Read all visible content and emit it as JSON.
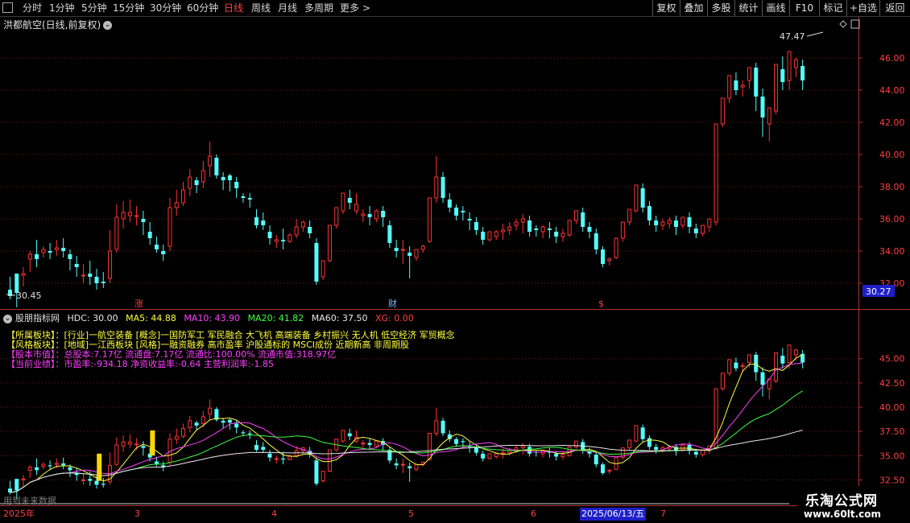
{
  "toolbar": {
    "periods": [
      "分时",
      "1分钟",
      "5分钟",
      "15分钟",
      "30分钟",
      "60分钟",
      "日线",
      "周线",
      "月线",
      "多周期",
      "更多 >"
    ],
    "active_period": "日线",
    "buttons": [
      "复权",
      "叠加",
      "多股",
      "统计",
      "画线",
      "F10",
      "标记",
      "+自选",
      "返回"
    ]
  },
  "stock": {
    "title": "洪都航空(日线,前复权)"
  },
  "main_chart": {
    "y_ticks": [
      "46.00",
      "44.00",
      "42.00",
      "40.00",
      "38.00",
      "36.00",
      "34.00",
      "32.00"
    ],
    "high_label": "47.47",
    "low_label": "30.45",
    "price_tag": "30.27",
    "events": [
      "涨",
      "财",
      "$"
    ]
  },
  "indicator": {
    "name": "股朋指标网",
    "values": [
      {
        "label": "HDC: 30.00",
        "color": "#e8e8e8"
      },
      {
        "label": "MA5: 44.88",
        "color": "#ffff40"
      },
      {
        "label": "MA10: 43.90",
        "color": "#ff40ff"
      },
      {
        "label": "MA20: 41.82",
        "color": "#40ff40"
      },
      {
        "label": "MA60: 37.50",
        "color": "#e8e8e8"
      },
      {
        "label": "XG: 0.00",
        "color": "#ff4040"
      }
    ],
    "y_ticks": [
      "45.00",
      "42.50",
      "40.00",
      "37.50",
      "35.00",
      "32.50"
    ]
  },
  "info_lines": [
    {
      "label": "【所属板块】：",
      "text": "[行业]一航空装备 [概念]一国防军工 军民融合 大飞机 高端装备 乡村振兴 无人机 低空经济 军贸概念",
      "color": "#ffff40"
    },
    {
      "label": "【风格板块】：",
      "text": "[地域]一江西板块 [风格]一融资融券 高市盈率 沪股通标的 MSCI成份 近期新高 非周期股",
      "color": "#ffff40"
    },
    {
      "label": "【股本市值】：",
      "text": "总股本:7.17亿 流通盘:7.17亿 流通比:100.00% 流通市值:318.97亿",
      "color": "#ff40ff"
    },
    {
      "label": "【当前业绩】：",
      "text": "市盈率:-934.18 净资收益率:-0.64 主营利润率:-1.85",
      "color": "#ff40ff"
    }
  ],
  "no_future": "用到未来数据",
  "dates": {
    "year": "2025年",
    "months": [
      "3",
      "4",
      "5",
      "6",
      "7"
    ],
    "cursor_date": "2025/06/13/五"
  },
  "watermark": {
    "name": "乐淘公式网",
    "url": "www.60lt.com"
  },
  "chart_data": {
    "type": "candlestick",
    "up_color": "#ff3232",
    "down_color": "#54fcfc",
    "main_ylim": [
      31,
      47.8
    ],
    "candles": [
      [
        31.6,
        32.4,
        31.2,
        31.0
      ],
      [
        32.6,
        32.0,
        31.4,
        30.5
      ],
      [
        32.5,
        33.0,
        32.6,
        31.8
      ],
      [
        33.5,
        34.0,
        33.8,
        32.7
      ],
      [
        33.8,
        34.7,
        33.5,
        33.0
      ],
      [
        33.9,
        34.3,
        34.1,
        33.6
      ],
      [
        34.0,
        34.5,
        33.9,
        33.5
      ],
      [
        34.1,
        34.7,
        34.2,
        33.7
      ],
      [
        34.2,
        34.8,
        34.0,
        33.6
      ],
      [
        33.8,
        34.1,
        33.5,
        32.8
      ],
      [
        33.2,
        33.7,
        33.0,
        32.4
      ],
      [
        32.5,
        33.2,
        32.5,
        32.0
      ],
      [
        32.6,
        33.4,
        32.4,
        31.9
      ],
      [
        32.4,
        32.9,
        32.0,
        31.6
      ],
      [
        32.1,
        32.7,
        32.0,
        31.7
      ],
      [
        32.3,
        35.3,
        34.0,
        32.0
      ],
      [
        34.1,
        36.9,
        36.1,
        33.9
      ],
      [
        36.0,
        37.1,
        36.4,
        35.4
      ],
      [
        36.2,
        37.2,
        36.4,
        35.8
      ],
      [
        36.2,
        36.8,
        36.2,
        35.6
      ],
      [
        36.0,
        36.5,
        35.8,
        35.0
      ],
      [
        35.2,
        35.8,
        34.8,
        34.4
      ],
      [
        34.4,
        34.9,
        34.1,
        33.9
      ],
      [
        34.0,
        34.4,
        33.8,
        33.4
      ],
      [
        34.3,
        37.3,
        36.7,
        34.0
      ],
      [
        36.7,
        37.8,
        37.0,
        36.2
      ],
      [
        37.0,
        38.3,
        37.8,
        36.8
      ],
      [
        37.9,
        39.1,
        38.6,
        37.4
      ],
      [
        38.4,
        38.6,
        38.1,
        37.6
      ],
      [
        38.3,
        39.6,
        39.0,
        37.9
      ],
      [
        39.3,
        40.8,
        39.9,
        38.6
      ],
      [
        39.8,
        40.0,
        38.7,
        38.5
      ],
      [
        38.6,
        38.9,
        38.4,
        37.8
      ],
      [
        38.7,
        38.8,
        38.4,
        37.7
      ],
      [
        38.3,
        38.6,
        37.9,
        37.3
      ],
      [
        37.4,
        37.6,
        37.3,
        37.0
      ],
      [
        37.3,
        37.6,
        37.2,
        36.7
      ],
      [
        36.1,
        36.6,
        35.6,
        35.4
      ],
      [
        35.9,
        36.4,
        35.6,
        35.3
      ],
      [
        35.2,
        35.6,
        34.8,
        34.4
      ],
      [
        34.6,
        35.0,
        34.7,
        34.2
      ],
      [
        34.7,
        35.4,
        34.6,
        34.1
      ],
      [
        34.6,
        35.1,
        35.0,
        34.5
      ],
      [
        35.0,
        36.0,
        35.5,
        34.8
      ],
      [
        35.5,
        35.9,
        35.8,
        35.2
      ],
      [
        35.5,
        35.9,
        35.1,
        34.8
      ],
      [
        34.5,
        34.8,
        32.1,
        31.9
      ],
      [
        32.4,
        32.6,
        33.4,
        32.2
      ],
      [
        33.4,
        34.1,
        35.6,
        33.3
      ],
      [
        35.6,
        36.0,
        36.7,
        35.4
      ],
      [
        36.5,
        36.9,
        37.6,
        36.3
      ],
      [
        37.3,
        37.8,
        37.0,
        36.6
      ],
      [
        36.5,
        37.6,
        36.9,
        36.3
      ],
      [
        36.2,
        36.6,
        36.3,
        35.8
      ],
      [
        36.3,
        36.8,
        36.1,
        35.6
      ],
      [
        36.0,
        36.6,
        36.5,
        35.8
      ],
      [
        36.5,
        36.8,
        36.1,
        35.5
      ],
      [
        35.6,
        35.9,
        34.5,
        34.2
      ],
      [
        34.2,
        34.7,
        34.0,
        33.6
      ],
      [
        34.1,
        34.7,
        34.1,
        33.2
      ],
      [
        33.9,
        34.3,
        33.7,
        32.3
      ],
      [
        33.6,
        33.9,
        34.1,
        33.4
      ],
      [
        34.1,
        34.4,
        34.3,
        33.9
      ],
      [
        34.6,
        36.5,
        37.3,
        34.5
      ],
      [
        37.3,
        39.9,
        38.6,
        37.0
      ],
      [
        38.6,
        38.9,
        37.3,
        37.0
      ],
      [
        37.2,
        37.6,
        36.7,
        36.4
      ],
      [
        36.7,
        36.9,
        36.2,
        35.9
      ],
      [
        36.5,
        36.8,
        36.4,
        35.9
      ],
      [
        36.0,
        36.4,
        35.9,
        35.3
      ],
      [
        35.8,
        36.1,
        35.3,
        35.0
      ],
      [
        35.2,
        35.5,
        34.7,
        34.4
      ],
      [
        34.7,
        35.2,
        35.2,
        34.6
      ],
      [
        34.9,
        35.3,
        35.2,
        34.7
      ],
      [
        35.2,
        35.7,
        35.3,
        34.7
      ],
      [
        35.3,
        35.8,
        35.5,
        35.0
      ],
      [
        35.6,
        36.0,
        35.8,
        35.3
      ],
      [
        35.8,
        36.3,
        36.0,
        35.1
      ],
      [
        35.9,
        36.2,
        35.2,
        34.9
      ],
      [
        35.4,
        35.6,
        35.3,
        34.9
      ],
      [
        35.2,
        35.6,
        35.5,
        34.8
      ],
      [
        35.4,
        35.8,
        35.3,
        34.8
      ],
      [
        35.2,
        35.5,
        34.9,
        34.5
      ],
      [
        34.9,
        35.4,
        35.1,
        34.6
      ],
      [
        35.0,
        35.6,
        35.9,
        34.9
      ],
      [
        35.9,
        36.3,
        36.5,
        35.7
      ],
      [
        36.4,
        36.7,
        35.5,
        35.2
      ],
      [
        35.5,
        35.8,
        35.2,
        34.8
      ],
      [
        35.1,
        35.4,
        34.1,
        33.8
      ],
      [
        34.1,
        34.3,
        33.2,
        33.0
      ],
      [
        33.4,
        33.6,
        33.5,
        33.1
      ],
      [
        33.6,
        34.0,
        34.8,
        33.5
      ],
      [
        34.8,
        35.2,
        35.8,
        34.6
      ],
      [
        35.8,
        36.2,
        36.6,
        35.6
      ],
      [
        36.5,
        37.4,
        38.1,
        36.4
      ],
      [
        37.9,
        38.2,
        36.7,
        36.4
      ],
      [
        36.8,
        37.1,
        35.9,
        35.6
      ],
      [
        35.9,
        36.2,
        35.6,
        35.2
      ],
      [
        35.6,
        36.0,
        35.8,
        35.3
      ],
      [
        35.7,
        36.1,
        35.9,
        35.4
      ],
      [
        35.9,
        36.2,
        35.5,
        35.0
      ],
      [
        35.6,
        35.9,
        36.1,
        35.4
      ],
      [
        36.1,
        36.4,
        35.5,
        35.1
      ],
      [
        35.4,
        35.7,
        35.1,
        34.8
      ],
      [
        35.1,
        35.5,
        35.6,
        34.9
      ],
      [
        35.5,
        35.9,
        36.0,
        35.2
      ],
      [
        35.8,
        36.4,
        41.9,
        35.6
      ],
      [
        41.9,
        42.4,
        43.5,
        41.7
      ],
      [
        43.5,
        44.6,
        44.9,
        43.2
      ],
      [
        44.6,
        45.1,
        44.0,
        43.7
      ],
      [
        44.2,
        44.6,
        44.3,
        43.6
      ],
      [
        44.6,
        44.9,
        45.4,
        44.1
      ],
      [
        45.4,
        45.7,
        43.6,
        42.7
      ],
      [
        43.6,
        44.1,
        42.3,
        41.1
      ],
      [
        41.9,
        42.4,
        42.9,
        40.8
      ],
      [
        42.7,
        44.8,
        45.6,
        42.5
      ],
      [
        45.3,
        46.1,
        44.5,
        44.0
      ],
      [
        44.6,
        45.1,
        46.4,
        44.0
      ],
      [
        45.4,
        46.0,
        45.9,
        44.8
      ],
      [
        45.5,
        45.9,
        44.6,
        44.0
      ]
    ]
  }
}
